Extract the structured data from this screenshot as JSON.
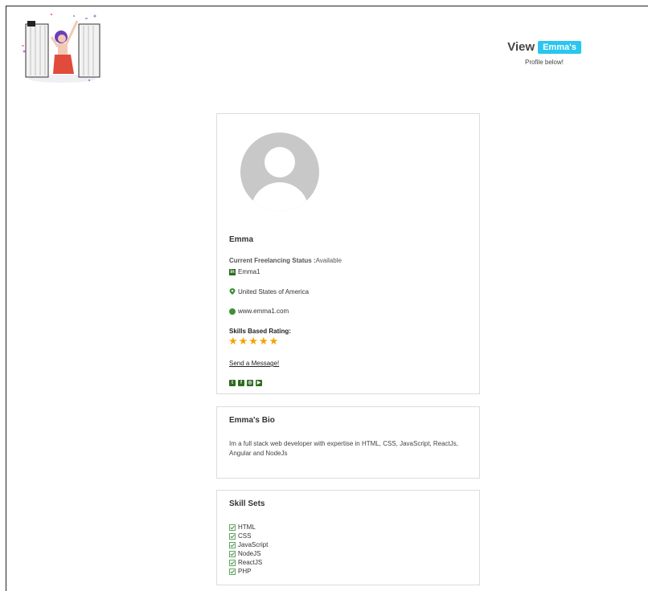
{
  "header": {
    "view_word": "View",
    "name_badge": "Emma's",
    "subtitle": "Profile below!"
  },
  "profile": {
    "name": "Emma",
    "status_label": "Current Freelancing Status :",
    "status_value": "Available",
    "linkedin": "Emma1",
    "location": "United States of America",
    "website": "www.emma1.com",
    "rating_label": "Skills Based Rating:",
    "stars": "★★★★★",
    "rating": 5,
    "send_message": "Send a Message!",
    "social_icons": [
      "twitter-icon",
      "facebook-icon",
      "instagram-icon",
      "youtube-icon"
    ]
  },
  "bio": {
    "title": "Emma's Bio",
    "text": "Im a full stack web developer with expertise in HTML, CSS, JavaScript, ReactJs, Angular and NodeJs"
  },
  "skills": {
    "title": "Skill Sets",
    "items": [
      "HTML",
      "CSS",
      "JavaScript",
      "NodeJS",
      "ReactJS",
      "PHP"
    ]
  },
  "colors": {
    "badge": "#29c6ef",
    "icon_green": "#2e6b1f",
    "star": "#f4a300"
  }
}
